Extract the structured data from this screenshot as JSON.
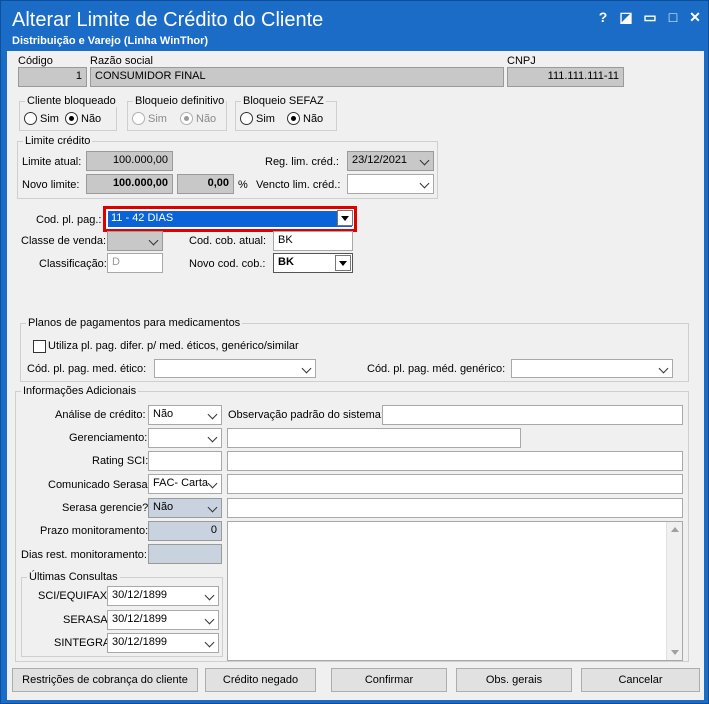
{
  "window": {
    "title": "Alterar Limite de Crédito do Cliente",
    "subtitle": "Distribuição e Varejo (Linha WinThor)",
    "help": "?",
    "restore": "◪",
    "minimize": "▭",
    "maximize": "□",
    "close": "✕"
  },
  "cliente": {
    "codigo_label": "Código",
    "codigo": "1",
    "razao_label": "Razão social",
    "razao": "CONSUMIDOR FINAL",
    "cnpj_label": "CNPJ",
    "cnpj": "111.111.111-11"
  },
  "radios": {
    "bloqueado": {
      "title": "Cliente bloqueado",
      "sim": "Sim",
      "nao": "Não"
    },
    "definitivo": {
      "title": "Bloqueio definitivo",
      "sim": "Sim",
      "nao": "Não"
    },
    "sefaz": {
      "title": "Bloqueio SEFAZ",
      "sim": "Sim",
      "nao": "Não"
    }
  },
  "limite": {
    "title": "Limite crédito",
    "atual_label": "Limite atual:",
    "atual": "100.000,00",
    "novo_label": "Novo limite:",
    "novo": "100.000,00",
    "pct": "0,00",
    "pct_sign": "%",
    "reg_label": "Reg. lim. créd.:",
    "reg": "23/12/2021",
    "vencto_label": "Vencto lim. créd.:",
    "vencto": ""
  },
  "pagamento": {
    "codpl_label": "Cod. pl. pag.:",
    "codpl": "11 - 42 DIAS",
    "classe_label": "Classe de venda:",
    "classe": "",
    "classif_label": "Classificação:",
    "classif": "D",
    "cobatual_label": "Cod. cob. atual:",
    "cobatual": "BK",
    "novocob_label": "Novo cod. cob.:",
    "novocob": "BK"
  },
  "medicamentos": {
    "title": "Planos de pagamentos para medicamentos",
    "check_label": "Utiliza pl. pag. difer. p/ med. éticos, genérico/similar",
    "etico_label": "Cód. pl. pag. med. ético:",
    "generico_label": "Cód. pl. pag. méd. genérico:"
  },
  "info": {
    "title": "Informações Adicionais",
    "analise_label": "Análise de crédito:",
    "analise": "Não",
    "obs_label": "Observação padrão do sistema:",
    "gerenc_label": "Gerenciamento:",
    "rating_label": "Rating SCI:",
    "serasa_label": "Comunicado Serasa:",
    "serasa": "FAC- Carta",
    "serasag_label": "Serasa gerencie?",
    "serasag": "Não",
    "prazo_label": "Prazo monitoramento:",
    "prazo": "0",
    "dias_label": "Dias rest. monitoramento:"
  },
  "consultas": {
    "title": "Últimas Consultas",
    "rows": [
      {
        "label": "SCI/EQUIFAX",
        "date": "30/12/1899"
      },
      {
        "label": "SERASA",
        "date": "30/12/1899"
      },
      {
        "label": "SINTEGRA",
        "date": "30/12/1899"
      }
    ]
  },
  "buttons": {
    "restricoes": "Restrições de cobrança do cliente",
    "negado": "Crédito negado",
    "confirmar": "Confirmar",
    "obs": "Obs. gerais",
    "cancelar": "Cancelar"
  },
  "colors": {
    "titlebar": "#1b6cc6",
    "highlight": "#e00000",
    "selection": "#0a64d8"
  }
}
